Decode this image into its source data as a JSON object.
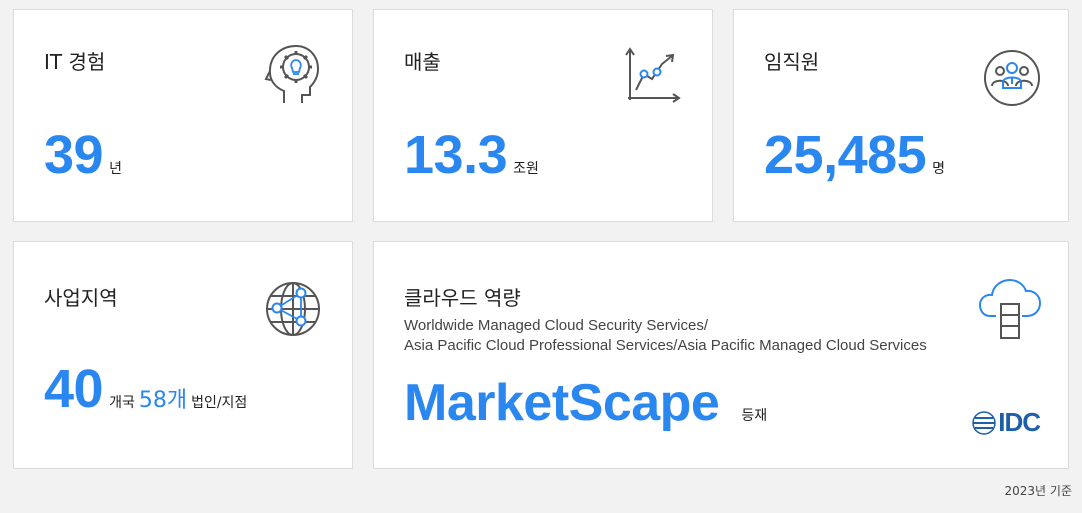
{
  "cards": {
    "it": {
      "title": "IT 경험",
      "value": "39",
      "unit": "년",
      "icon": "head-gear-bulb-icon"
    },
    "sales": {
      "title": "매출",
      "value": "13.3",
      "unit": "조원",
      "icon": "growth-chart-icon"
    },
    "employees": {
      "title": "임직원",
      "value": "25,485",
      "unit": "명",
      "icon": "people-group-icon"
    },
    "region": {
      "title": "사업지역",
      "value": "40",
      "unit_prefix": "개국",
      "sub_value": "58개",
      "unit_suffix": "법인/지점",
      "icon": "globe-network-icon"
    },
    "cloud": {
      "title": "클라우드 역량",
      "subtitle_line1": "Worldwide Managed Cloud Security Services/",
      "subtitle_line2": "Asia Pacific Cloud Professional Services/Asia Pacific Managed Cloud Services",
      "headline": "MarketScape",
      "headline_unit": "등재",
      "logo_text": "IDC",
      "icon": "cloud-server-icon"
    }
  },
  "footnote": "2023년 기준",
  "colors": {
    "accent": "#2b87f0",
    "icon_stroke": "#555555",
    "icon_highlight": "#2b87f0",
    "idc_blue": "#1d5fa8"
  }
}
